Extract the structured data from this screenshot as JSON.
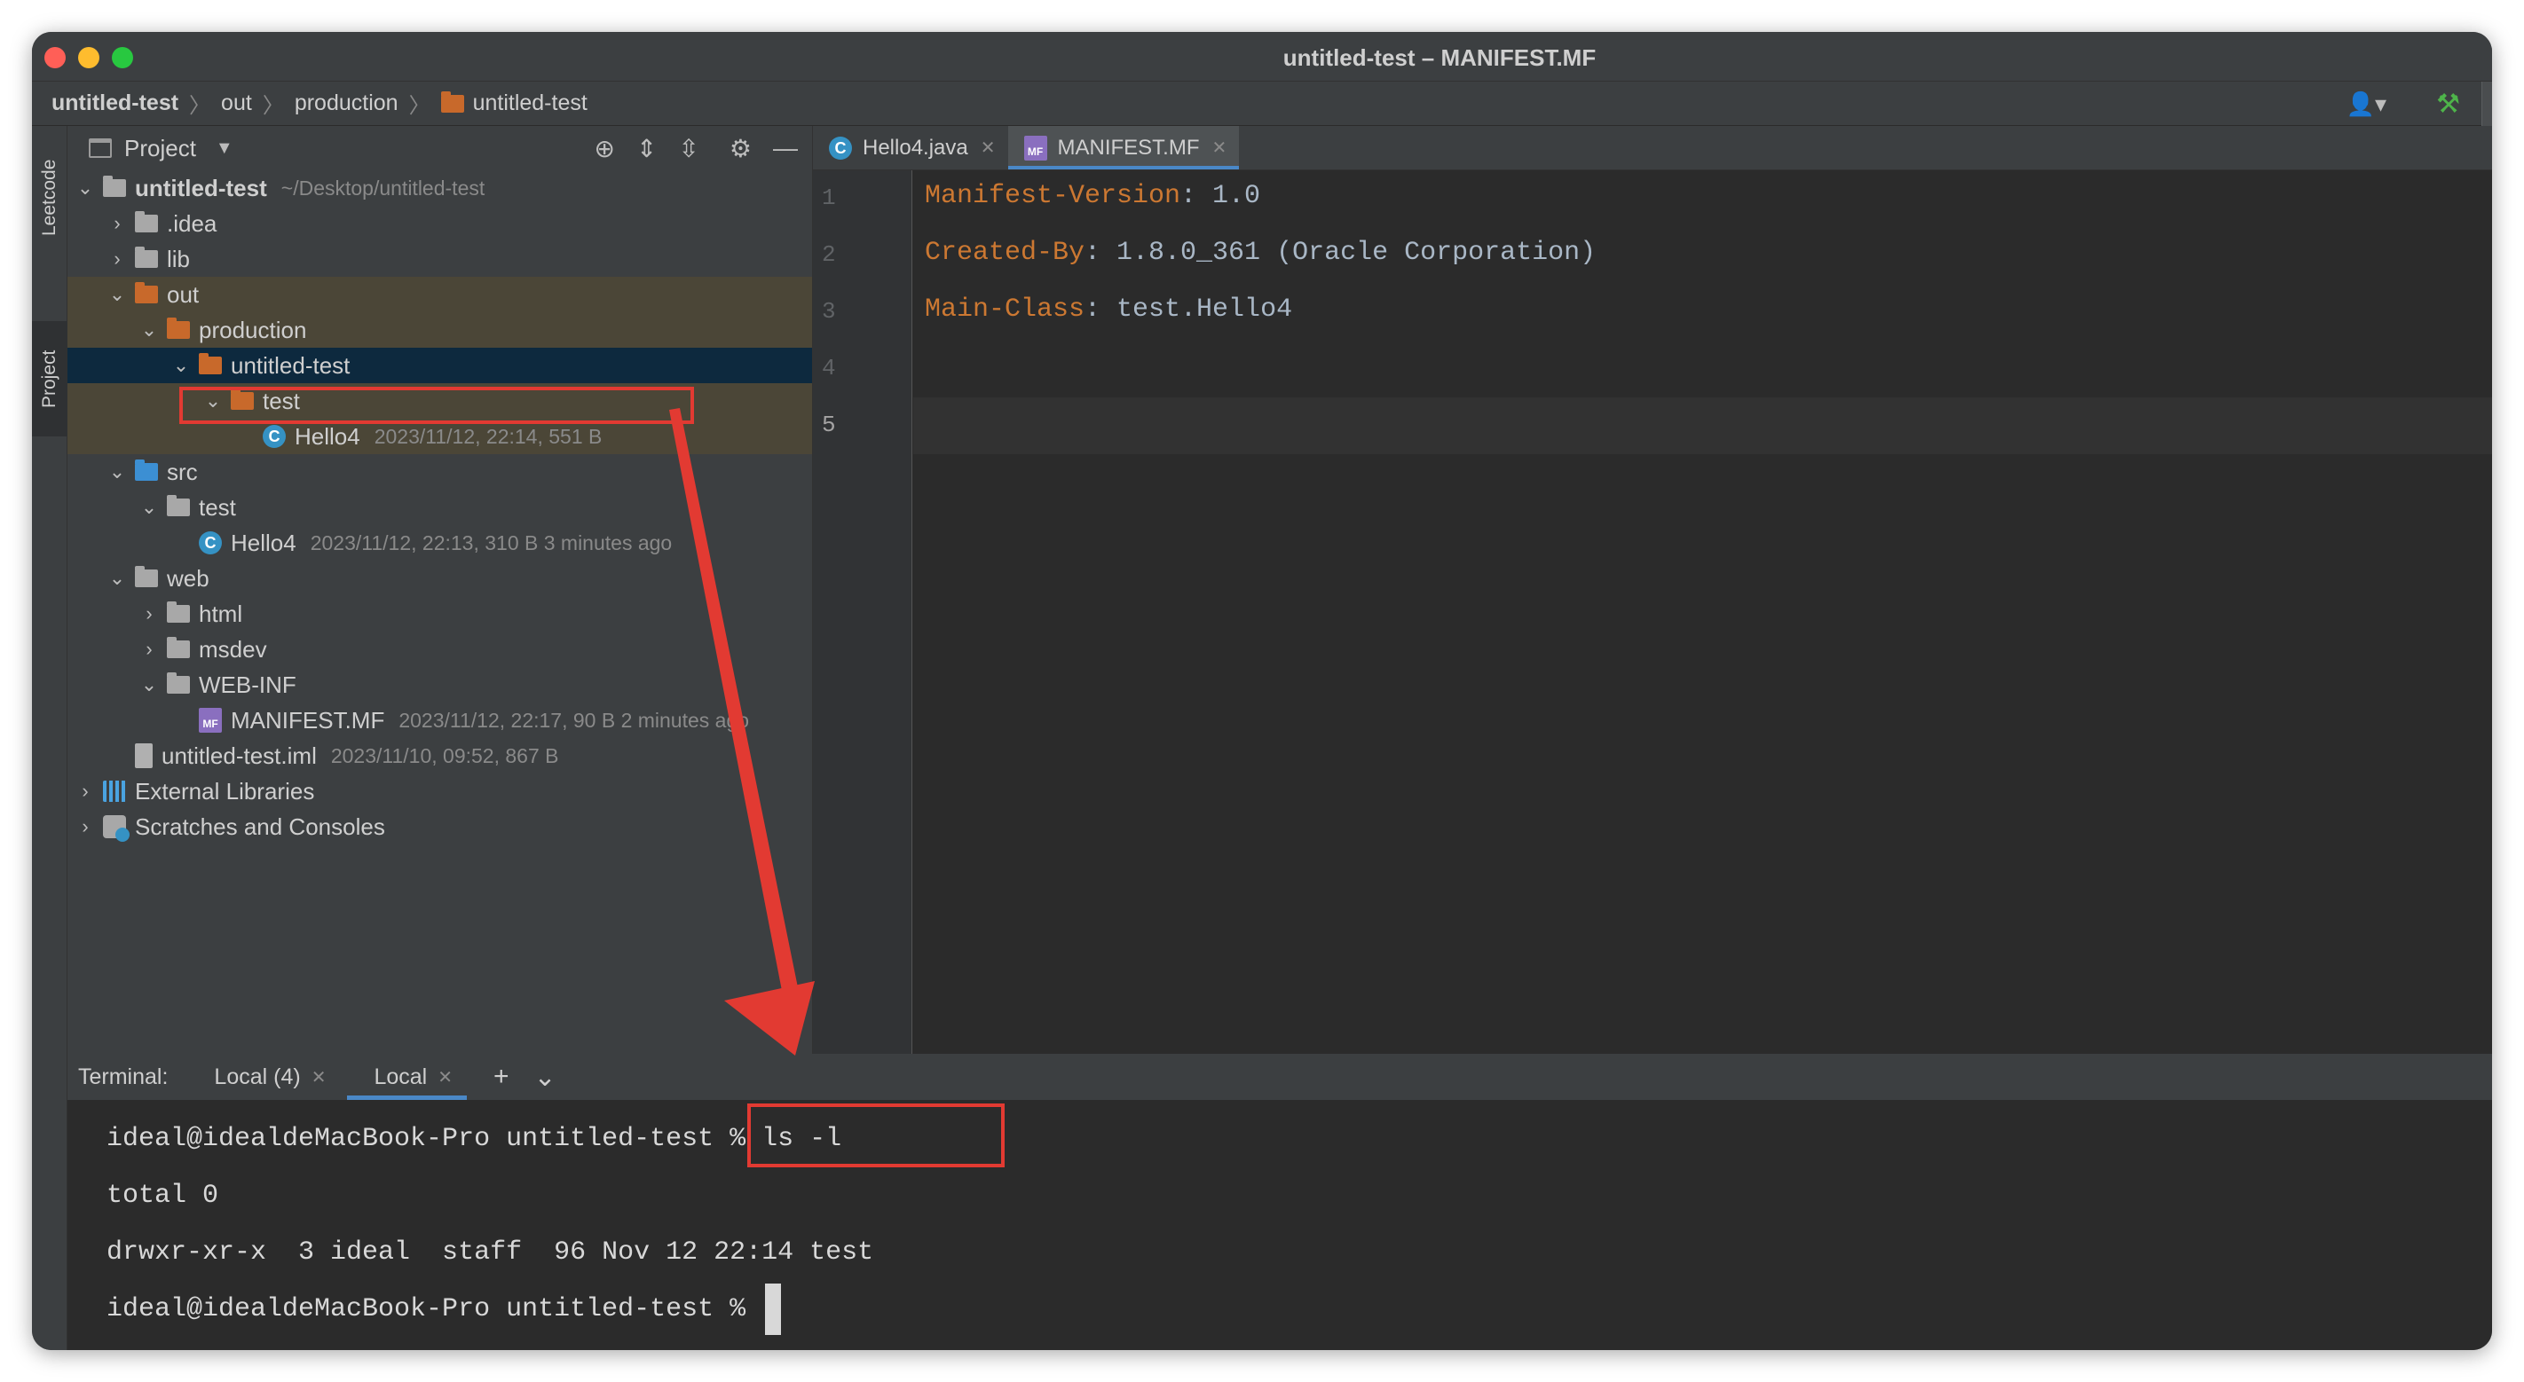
{
  "window": {
    "title": "untitled-test – MANIFEST.MF"
  },
  "breadcrumb": [
    "untitled-test",
    "out",
    "production",
    "untitled-test"
  ],
  "toolstrip": {
    "leetcode": "Leetcode",
    "project": "Project"
  },
  "project": {
    "title": "Project",
    "tree": [
      {
        "label": "untitled-test",
        "meta": "~/Desktop/untitled-test"
      },
      {
        "label": ".idea"
      },
      {
        "label": "lib"
      },
      {
        "label": "out"
      },
      {
        "label": "production"
      },
      {
        "label": "untitled-test"
      },
      {
        "label": "test"
      },
      {
        "label": "Hello4",
        "meta": "2023/11/12, 22:14, 551 B"
      },
      {
        "label": "src"
      },
      {
        "label": "test"
      },
      {
        "label": "Hello4",
        "meta": "2023/11/12, 22:13, 310 B 3 minutes ago"
      },
      {
        "label": "web"
      },
      {
        "label": "html"
      },
      {
        "label": "msdev"
      },
      {
        "label": "WEB-INF"
      },
      {
        "label": "MANIFEST.MF",
        "meta": "2023/11/12, 22:17, 90 B 2 minutes ago"
      },
      {
        "label": "untitled-test.iml",
        "meta": "2023/11/10, 09:52, 867 B"
      },
      {
        "label": "External Libraries"
      },
      {
        "label": "Scratches and Consoles"
      }
    ]
  },
  "editor": {
    "tabs": [
      {
        "label": "Hello4.java"
      },
      {
        "label": "MANIFEST.MF"
      }
    ],
    "line_numbers": [
      "1",
      "2",
      "3",
      "4",
      "5"
    ],
    "lines": [
      {
        "key": "Manifest-Version",
        "value": ": 1.0"
      },
      {
        "key": "Created-By",
        "value": ": 1.8.0_361 (Oracle Corporation)"
      },
      {
        "key": "Main-Class",
        "value": ": test.Hello4"
      }
    ]
  },
  "terminal": {
    "label": "Terminal:",
    "tabs": [
      {
        "label": "Local (4)"
      },
      {
        "label": "Local"
      }
    ],
    "add": "+",
    "more": "⌄",
    "prompt": "ideal@idealdeMacBook-Pro untitled-test % ",
    "command": "ls -l",
    "output": [
      "total 0",
      "drwxr-xr-x  3 ideal  staff  96 Nov 12 22:14 test"
    ],
    "prompt2": "ideal@idealdeMacBook-Pro untitled-test % "
  },
  "colors": {
    "annotation_red": "#e23a32",
    "keyword_orange": "#cc7832",
    "selection_blue": "#0d293e",
    "highlight_brown": "#4b4637"
  }
}
